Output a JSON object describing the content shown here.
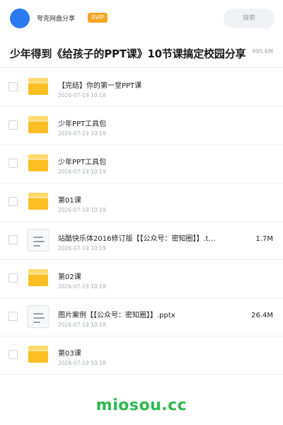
{
  "header": {
    "user_name": "夸克网盘分享",
    "badge": "SVIP",
    "search_label": "搜索"
  },
  "title_bar": {
    "title": "少年得到《给孩子的PPT课》10节课搞定校园分享",
    "total_size": "995.6M"
  },
  "files": [
    {
      "type": "folder",
      "name": "【完结】你的第一堂PPT课",
      "date": "2026-07-19 10:18",
      "size": ""
    },
    {
      "type": "folder",
      "name": "少年PPT工具包",
      "date": "2026-07-19 10:19",
      "size": ""
    },
    {
      "type": "folder",
      "name": "少年PPT工具包",
      "date": "2026-07-19 10:19",
      "size": ""
    },
    {
      "type": "folder",
      "name": "第01课",
      "date": "2026-07-19 10:19",
      "size": ""
    },
    {
      "type": "document",
      "name": "站酷快乐体2016修订版【【公众号：密知圈】】.t…",
      "date": "2026-07-19 10:19",
      "size": "1.7M"
    },
    {
      "type": "folder",
      "name": "第02课",
      "date": "2026-07-19 10:18",
      "size": ""
    },
    {
      "type": "document",
      "name": "图片案例【【公众号：密知圈】】.pptx",
      "date": "2026-07-19 10:18",
      "size": "26.4M"
    },
    {
      "type": "folder",
      "name": "第03课",
      "date": "2026-07-19 10:18",
      "size": ""
    }
  ],
  "watermark": "miosou.cc",
  "colors": {
    "avatar": "#2b7bf0",
    "badge": "#f5a623",
    "folder": "#fbbf24",
    "watermark": "#2db84d"
  }
}
